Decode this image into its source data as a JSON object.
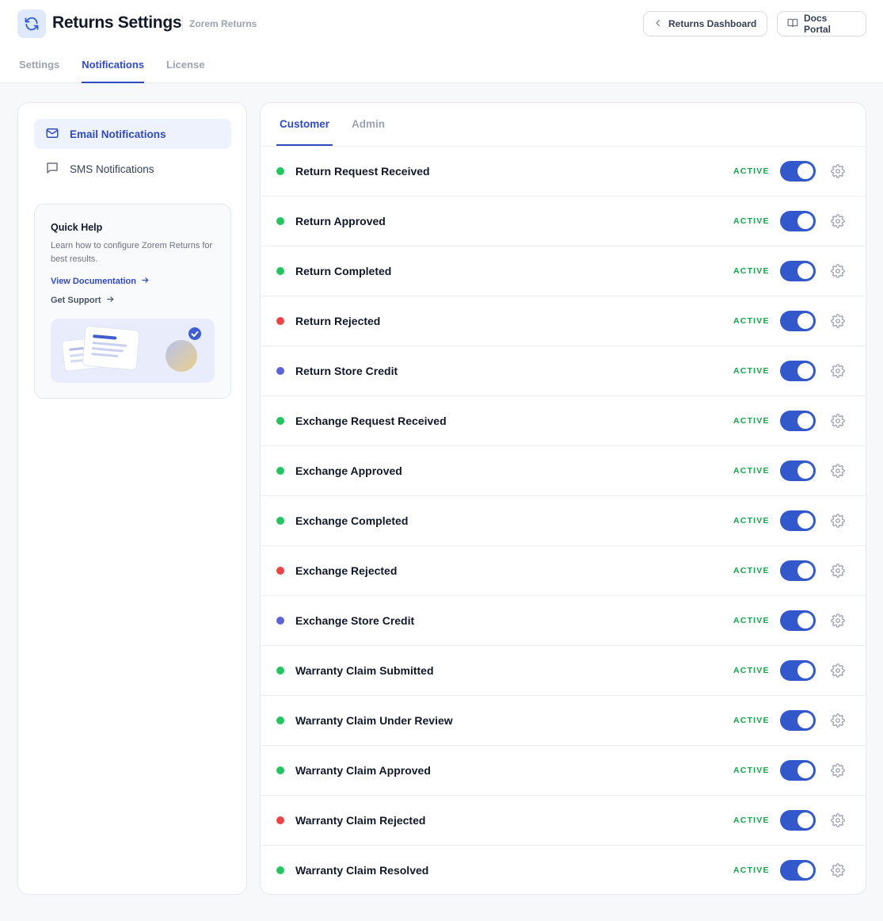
{
  "header": {
    "title": "Returns Settings",
    "subtitle": "Zorem Returns",
    "dashboard_button": "Returns Dashboard",
    "docs_button": "Docs Portal"
  },
  "top_tabs": [
    {
      "label": "Settings",
      "active": false
    },
    {
      "label": "Notifications",
      "active": true
    },
    {
      "label": "License",
      "active": false
    }
  ],
  "sidebar": {
    "items": [
      {
        "label": "Email Notifications",
        "icon": "mail-icon",
        "active": true
      },
      {
        "label": "SMS Notifications",
        "icon": "chat-icon",
        "active": false
      }
    ],
    "help": {
      "title": "Quick Help",
      "text": "Learn how to configure Zorem Returns for best results.",
      "doc_link": "View Documentation",
      "support_link": "Get Support"
    }
  },
  "sub_tabs": [
    {
      "label": "Customer",
      "active": true
    },
    {
      "label": "Admin",
      "active": false
    }
  ],
  "colors": {
    "accent": "#2f4bbf",
    "toggle_on": "#3358cc",
    "active_status": "#16a34a",
    "dot_green": "#22c55e",
    "dot_red": "#ef4444",
    "dot_indigo": "#5b63d9"
  },
  "notifications": [
    {
      "label": "Return Request Received",
      "status": "ACTIVE",
      "dot": "green",
      "enabled": true
    },
    {
      "label": "Return Approved",
      "status": "ACTIVE",
      "dot": "green",
      "enabled": true
    },
    {
      "label": "Return Completed",
      "status": "ACTIVE",
      "dot": "green",
      "enabled": true
    },
    {
      "label": "Return Rejected",
      "status": "ACTIVE",
      "dot": "red",
      "enabled": true
    },
    {
      "label": "Return Store Credit",
      "status": "ACTIVE",
      "dot": "indigo",
      "enabled": true
    },
    {
      "label": "Exchange Request Received",
      "status": "ACTIVE",
      "dot": "green",
      "enabled": true
    },
    {
      "label": "Exchange Approved",
      "status": "ACTIVE",
      "dot": "green",
      "enabled": true
    },
    {
      "label": "Exchange Completed",
      "status": "ACTIVE",
      "dot": "green",
      "enabled": true
    },
    {
      "label": "Exchange Rejected",
      "status": "ACTIVE",
      "dot": "red",
      "enabled": true
    },
    {
      "label": "Exchange Store Credit",
      "status": "ACTIVE",
      "dot": "indigo",
      "enabled": true
    },
    {
      "label": "Warranty Claim Submitted",
      "status": "ACTIVE",
      "dot": "green",
      "enabled": true
    },
    {
      "label": "Warranty Claim Under Review",
      "status": "ACTIVE",
      "dot": "green",
      "enabled": true
    },
    {
      "label": "Warranty Claim Approved",
      "status": "ACTIVE",
      "dot": "green",
      "enabled": true
    },
    {
      "label": "Warranty Claim Rejected",
      "status": "ACTIVE",
      "dot": "red",
      "enabled": true
    },
    {
      "label": "Warranty Claim Resolved",
      "status": "ACTIVE",
      "dot": "green",
      "enabled": true
    }
  ]
}
